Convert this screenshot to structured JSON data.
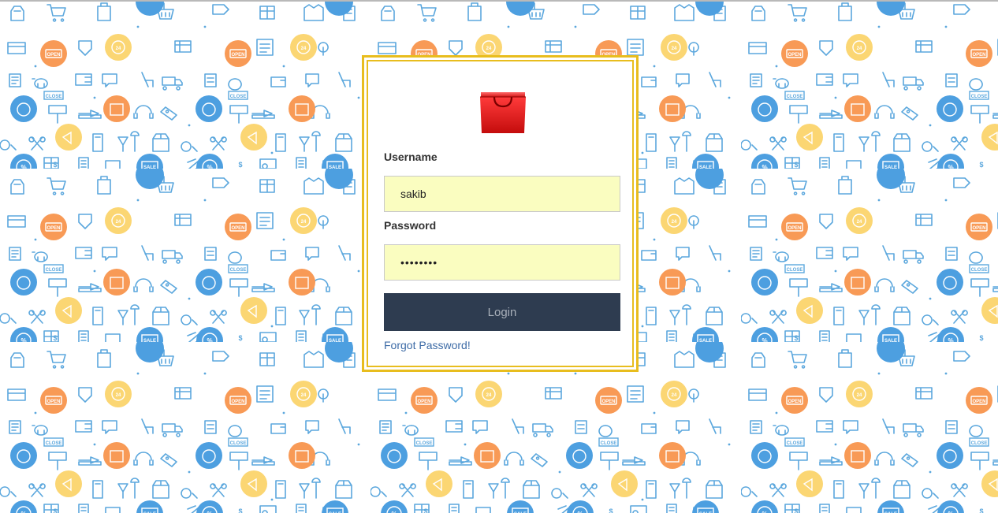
{
  "background": {
    "pattern_icons": [
      "shopping-bag-icon",
      "shopping-cart-icon",
      "shopping-basket-icon",
      "price-tag-icon",
      "gift-icon",
      "delivery-truck-icon",
      "credit-card-icon",
      "piggy-bank-icon",
      "wallet-icon",
      "headphones-icon",
      "sneaker-icon",
      "stopwatch-icon",
      "open-sign-icon",
      "close-sign-icon",
      "sale-sign-icon",
      "megaphone-icon",
      "magnifier-icon",
      "scissors-icon",
      "percent-badge-icon",
      "calculator-icon",
      "t-shirt-icon",
      "store-icon",
      "24-hour-icon",
      "location-pin-icon",
      "box-icon",
      "laptop-cart-icon"
    ],
    "badge_labels": {
      "open": "OPEN",
      "close": "CLOSE",
      "sale": "SALE",
      "hours": "24",
      "percent": "%",
      "dollar": "$"
    },
    "colors": {
      "line": "#5ba7dd",
      "blue": "#4d9fe0",
      "orange": "#f89a56",
      "yellow": "#fbd673",
      "bg": "#ffffff"
    }
  },
  "login": {
    "logo_icon": "shopping-bag-icon",
    "username_label": "Username",
    "username_value": "sakib",
    "password_label": "Password",
    "password_value": "••••••••",
    "login_button": "Login",
    "forgot_link": "Forgot Password!",
    "colors": {
      "frame": "#e8bd1e",
      "input_bg": "#fafdc0",
      "button_bg": "#2e3c50",
      "button_text": "#a9b0ba",
      "link": "#3d6ba6"
    }
  }
}
